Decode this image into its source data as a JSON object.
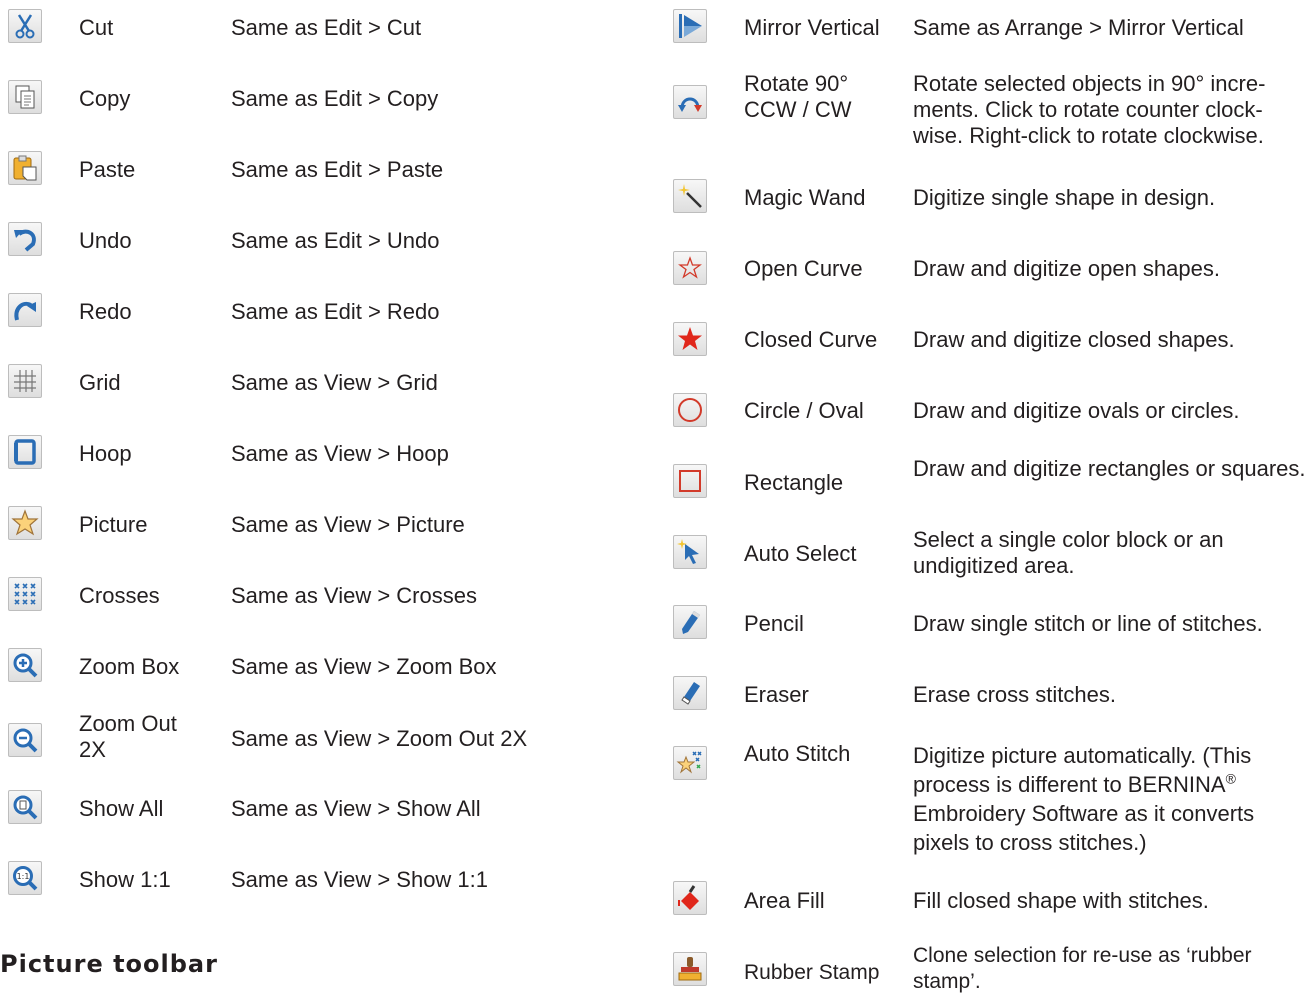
{
  "left": [
    {
      "icon": "scissors-icon",
      "name": "Cut",
      "desc": "Same as Edit > Cut"
    },
    {
      "icon": "copy-icon",
      "name": "Copy",
      "desc": "Same as Edit > Copy"
    },
    {
      "icon": "paste-icon",
      "name": "Paste",
      "desc": "Same as Edit > Paste"
    },
    {
      "icon": "undo-icon",
      "name": "Undo",
      "desc": "Same as Edit > Undo"
    },
    {
      "icon": "redo-icon",
      "name": "Redo",
      "desc": "Same as Edit > Redo"
    },
    {
      "icon": "grid-icon",
      "name": "Grid",
      "desc": "Same as View > Grid"
    },
    {
      "icon": "hoop-icon",
      "name": "Hoop",
      "desc": "Same as View > Hoop"
    },
    {
      "icon": "picture-icon",
      "name": "Picture",
      "desc": "Same as View > Picture"
    },
    {
      "icon": "crosses-icon",
      "name": "Crosses",
      "desc": "Same as View > Crosses"
    },
    {
      "icon": "zoom-in-icon",
      "name": "Zoom Box",
      "desc": "Same as View > Zoom Box"
    },
    {
      "icon": "zoom-out-icon",
      "name": "Zoom Out 2X",
      "desc": "Same as View > Zoom Out 2X"
    },
    {
      "icon": "show-all-icon",
      "name": "Show All",
      "desc": "Same as View > Show All"
    },
    {
      "icon": "show-1-1-icon",
      "name": "Show 1:1",
      "desc": "Same as View > Show 1:1"
    }
  ],
  "right": [
    {
      "icon": "mirror-vertical-icon",
      "name": "Mirror Vertical",
      "desc": "Same as Arrange > Mirror Vertical"
    },
    {
      "icon": "rotate-icon",
      "name": "Rotate 90° CCW / CW",
      "desc": "Rotate selected objects in 90° incre-ments. Click to rotate counter clock-wise. Right-click to rotate clockwise."
    },
    {
      "icon": "magic-wand-icon",
      "name": "Magic Wand",
      "desc": "Digitize single shape in design."
    },
    {
      "icon": "open-star-icon",
      "name": "Open Curve",
      "desc": "Draw and digitize open shapes."
    },
    {
      "icon": "closed-star-icon",
      "name": "Closed Curve",
      "desc": "Draw and digitize closed shapes."
    },
    {
      "icon": "circle-icon",
      "name": "Circle / Oval",
      "desc": "Draw and digitize ovals or circles."
    },
    {
      "icon": "rectangle-icon",
      "name": "Rectangle",
      "desc": "Draw and digitize rectangles or squares."
    },
    {
      "icon": "auto-select-icon",
      "name": "Auto Select",
      "desc": "Select a single color block or an undigitized area."
    },
    {
      "icon": "pencil-icon",
      "name": "Pencil",
      "desc": "Draw single stitch or line of stitches."
    },
    {
      "icon": "eraser-icon",
      "name": "Eraser",
      "desc": "Erase cross stitches."
    },
    {
      "icon": "auto-stitch-icon",
      "name": "Auto Stitch",
      "desc": "Digitize picture automatically. (This process is different to BERNINA",
      "desc_sup": "®",
      "desc_tail": " Embroidery Software as it converts pixels to cross stitches.)"
    },
    {
      "icon": "area-fill-icon",
      "name": "Area Fill",
      "desc": "Fill closed shape with stitches."
    },
    {
      "icon": "rubber-stamp-icon",
      "name": "Rubber Stamp",
      "desc": "Clone selection for re-use as ‘rubber stamp’."
    }
  ],
  "section_heading": "Picture toolbar"
}
